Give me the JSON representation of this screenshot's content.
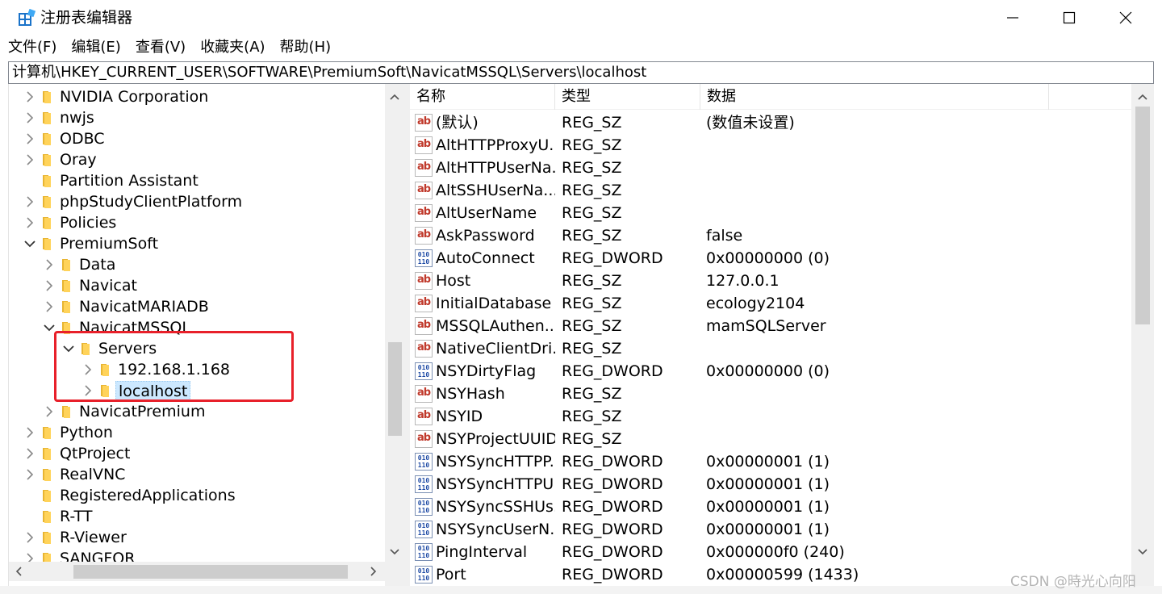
{
  "window": {
    "title": "注册表编辑器",
    "icon": "regedit-icon",
    "controls": [
      "minimize",
      "maximize",
      "close"
    ]
  },
  "menu": [
    "文件(F)",
    "编辑(E)",
    "查看(V)",
    "收藏夹(A)",
    "帮助(H)"
  ],
  "address": "计算机\\HKEY_CURRENT_USER\\SOFTWARE\\PremiumSoft\\NavicatMSSQL\\Servers\\localhost",
  "tree": [
    {
      "label": "NVIDIA Corporation",
      "depth": 0,
      "expander": "collapsed"
    },
    {
      "label": "nwjs",
      "depth": 0,
      "expander": "collapsed"
    },
    {
      "label": "ODBC",
      "depth": 0,
      "expander": "collapsed"
    },
    {
      "label": "Oray",
      "depth": 0,
      "expander": "collapsed"
    },
    {
      "label": "Partition Assistant",
      "depth": 0,
      "expander": "none"
    },
    {
      "label": "phpStudyClientPlatform",
      "depth": 0,
      "expander": "collapsed"
    },
    {
      "label": "Policies",
      "depth": 0,
      "expander": "collapsed"
    },
    {
      "label": "PremiumSoft",
      "depth": 0,
      "expander": "expanded"
    },
    {
      "label": "Data",
      "depth": 1,
      "expander": "collapsed"
    },
    {
      "label": "Navicat",
      "depth": 1,
      "expander": "collapsed"
    },
    {
      "label": "NavicatMARIADB",
      "depth": 1,
      "expander": "collapsed"
    },
    {
      "label": "NavicatMSSQL",
      "depth": 1,
      "expander": "expanded"
    },
    {
      "label": "Servers",
      "depth": 2,
      "expander": "expanded"
    },
    {
      "label": "192.168.1.168",
      "depth": 3,
      "expander": "collapsed"
    },
    {
      "label": "localhost",
      "depth": 3,
      "expander": "collapsed",
      "selected": true
    },
    {
      "label": "NavicatPremium",
      "depth": 1,
      "expander": "collapsed"
    },
    {
      "label": "Python",
      "depth": 0,
      "expander": "collapsed"
    },
    {
      "label": "QtProject",
      "depth": 0,
      "expander": "collapsed"
    },
    {
      "label": "RealVNC",
      "depth": 0,
      "expander": "collapsed"
    },
    {
      "label": "RegisteredApplications",
      "depth": 0,
      "expander": "none"
    },
    {
      "label": "R-TT",
      "depth": 0,
      "expander": "none"
    },
    {
      "label": "R-Viewer",
      "depth": 0,
      "expander": "collapsed"
    },
    {
      "label": "SANGFOR",
      "depth": 0,
      "expander": "collapsed"
    }
  ],
  "columns": [
    "名称",
    "类型",
    "数据"
  ],
  "values": [
    {
      "name": "(默认)",
      "type": "REG_SZ",
      "data": "(数值未设置)",
      "icon": "string-value-icon"
    },
    {
      "name": "AltHTTPProxyU...",
      "type": "REG_SZ",
      "data": "",
      "icon": "string-value-icon"
    },
    {
      "name": "AltHTTPUserNa...",
      "type": "REG_SZ",
      "data": "",
      "icon": "string-value-icon"
    },
    {
      "name": "AltSSHUserNa...",
      "type": "REG_SZ",
      "data": "",
      "icon": "string-value-icon"
    },
    {
      "name": "AltUserName",
      "type": "REG_SZ",
      "data": "",
      "icon": "string-value-icon"
    },
    {
      "name": "AskPassword",
      "type": "REG_SZ",
      "data": "false",
      "icon": "string-value-icon"
    },
    {
      "name": "AutoConnect",
      "type": "REG_DWORD",
      "data": "0x00000000 (0)",
      "icon": "binary-value-icon"
    },
    {
      "name": "Host",
      "type": "REG_SZ",
      "data": "127.0.0.1",
      "icon": "string-value-icon"
    },
    {
      "name": "InitialDatabase",
      "type": "REG_SZ",
      "data": "ecology2104",
      "icon": "string-value-icon"
    },
    {
      "name": "MSSQLAuthen...",
      "type": "REG_SZ",
      "data": "mamSQLServer",
      "icon": "string-value-icon"
    },
    {
      "name": "NativeClientDri...",
      "type": "REG_SZ",
      "data": "",
      "icon": "string-value-icon"
    },
    {
      "name": "NSYDirtyFlag",
      "type": "REG_DWORD",
      "data": "0x00000000 (0)",
      "icon": "binary-value-icon"
    },
    {
      "name": "NSYHash",
      "type": "REG_SZ",
      "data": "",
      "icon": "string-value-icon"
    },
    {
      "name": "NSYID",
      "type": "REG_SZ",
      "data": "",
      "icon": "string-value-icon"
    },
    {
      "name": "NSYProjectUUID",
      "type": "REG_SZ",
      "data": "",
      "icon": "string-value-icon"
    },
    {
      "name": "NSYSyncHTTPP...",
      "type": "REG_DWORD",
      "data": "0x00000001 (1)",
      "icon": "binary-value-icon"
    },
    {
      "name": "NSYSyncHTTPU...",
      "type": "REG_DWORD",
      "data": "0x00000001 (1)",
      "icon": "binary-value-icon"
    },
    {
      "name": "NSYSyncSSHUs...",
      "type": "REG_DWORD",
      "data": "0x00000001 (1)",
      "icon": "binary-value-icon"
    },
    {
      "name": "NSYSyncUserN...",
      "type": "REG_DWORD",
      "data": "0x00000001 (1)",
      "icon": "binary-value-icon"
    },
    {
      "name": "PingInterval",
      "type": "REG_DWORD",
      "data": "0x000000f0 (240)",
      "icon": "binary-value-icon"
    },
    {
      "name": "Port",
      "type": "REG_DWORD",
      "data": "0x00000599 (1433)",
      "icon": "binary-value-icon"
    }
  ],
  "annotation": {
    "color": "#e8202a"
  },
  "watermark": "CSDN @時光心向阳"
}
